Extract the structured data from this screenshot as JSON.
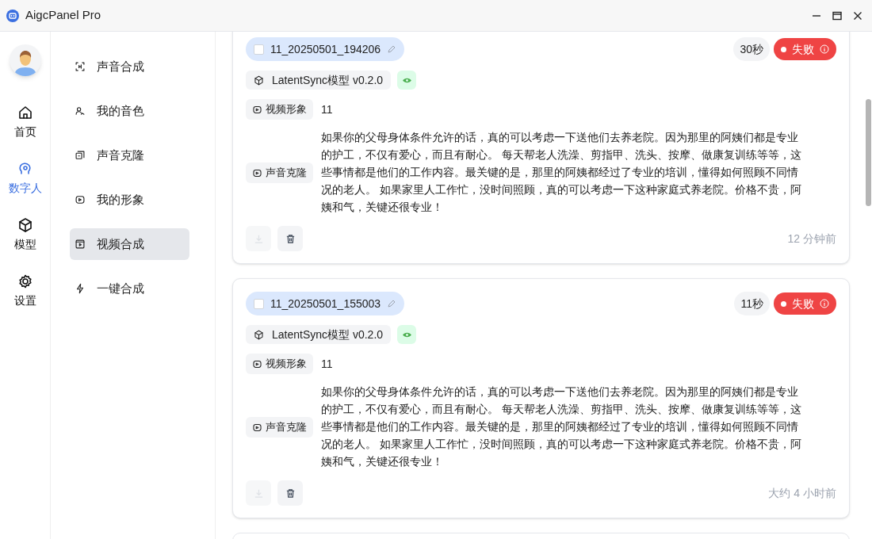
{
  "window": {
    "title": "AigcPanel Pro"
  },
  "rail": [
    {
      "label": "首页",
      "selected": false
    },
    {
      "label": "数字人",
      "selected": true
    },
    {
      "label": "模型",
      "selected": false
    },
    {
      "label": "设置",
      "selected": false
    }
  ],
  "menu": [
    {
      "label": "声音合成",
      "selected": false
    },
    {
      "label": "我的音色",
      "selected": false
    },
    {
      "label": "声音克隆",
      "selected": false
    },
    {
      "label": "我的形象",
      "selected": false
    },
    {
      "label": "视频合成",
      "selected": true
    },
    {
      "label": "一键合成",
      "selected": false
    }
  ],
  "tasks": [
    {
      "title": "11_20250501_194206",
      "checked": false,
      "duration": "30秒",
      "status": {
        "label": "失败",
        "kind": "failed"
      },
      "model": "LatentSync模型 v0.2.0",
      "video_label": "视频形象",
      "video_value": "11",
      "voice_label": "声音克隆",
      "text": "如果你的父母身体条件允许的话，真的可以考虑一下送他们去养老院。因为那里的阿姨们都是专业的护工，不仅有爱心，而且有耐心。 每天帮老人洗澡、剪指甲、洗头、按摩、做康复训练等等，这些事情都是他们的工作内容。最关键的是，那里的阿姨都经过了专业的培训，懂得如何照顾不同情况的老人。 如果家里人工作忙，没时间照顾，真的可以考虑一下这种家庭式养老院。价格不贵，阿姨和气，关键还很专业！",
      "download_disabled": true,
      "time": "12 分钟前"
    },
    {
      "title": "11_20250501_155003",
      "checked": false,
      "duration": "11秒",
      "status": {
        "label": "失败",
        "kind": "failed"
      },
      "model": "LatentSync模型 v0.2.0",
      "video_label": "视频形象",
      "video_value": "11",
      "voice_label": "声音克隆",
      "text": "如果你的父母身体条件允许的话，真的可以考虑一下送他们去养老院。因为那里的阿姨们都是专业的护工，不仅有爱心，而且有耐心。 每天帮老人洗澡、剪指甲、洗头、按摩、做康复训练等等，这些事情都是他们的工作内容。最关键的是，那里的阿姨都经过了专业的培训，懂得如何照顾不同情况的老人。 如果家里人工作忙，没时间照顾，真的可以考虑一下这种家庭式养老院。价格不贵，阿姨和气，关键还很专业！",
      "download_disabled": true,
      "time": "大约 4 小时前"
    }
  ]
}
